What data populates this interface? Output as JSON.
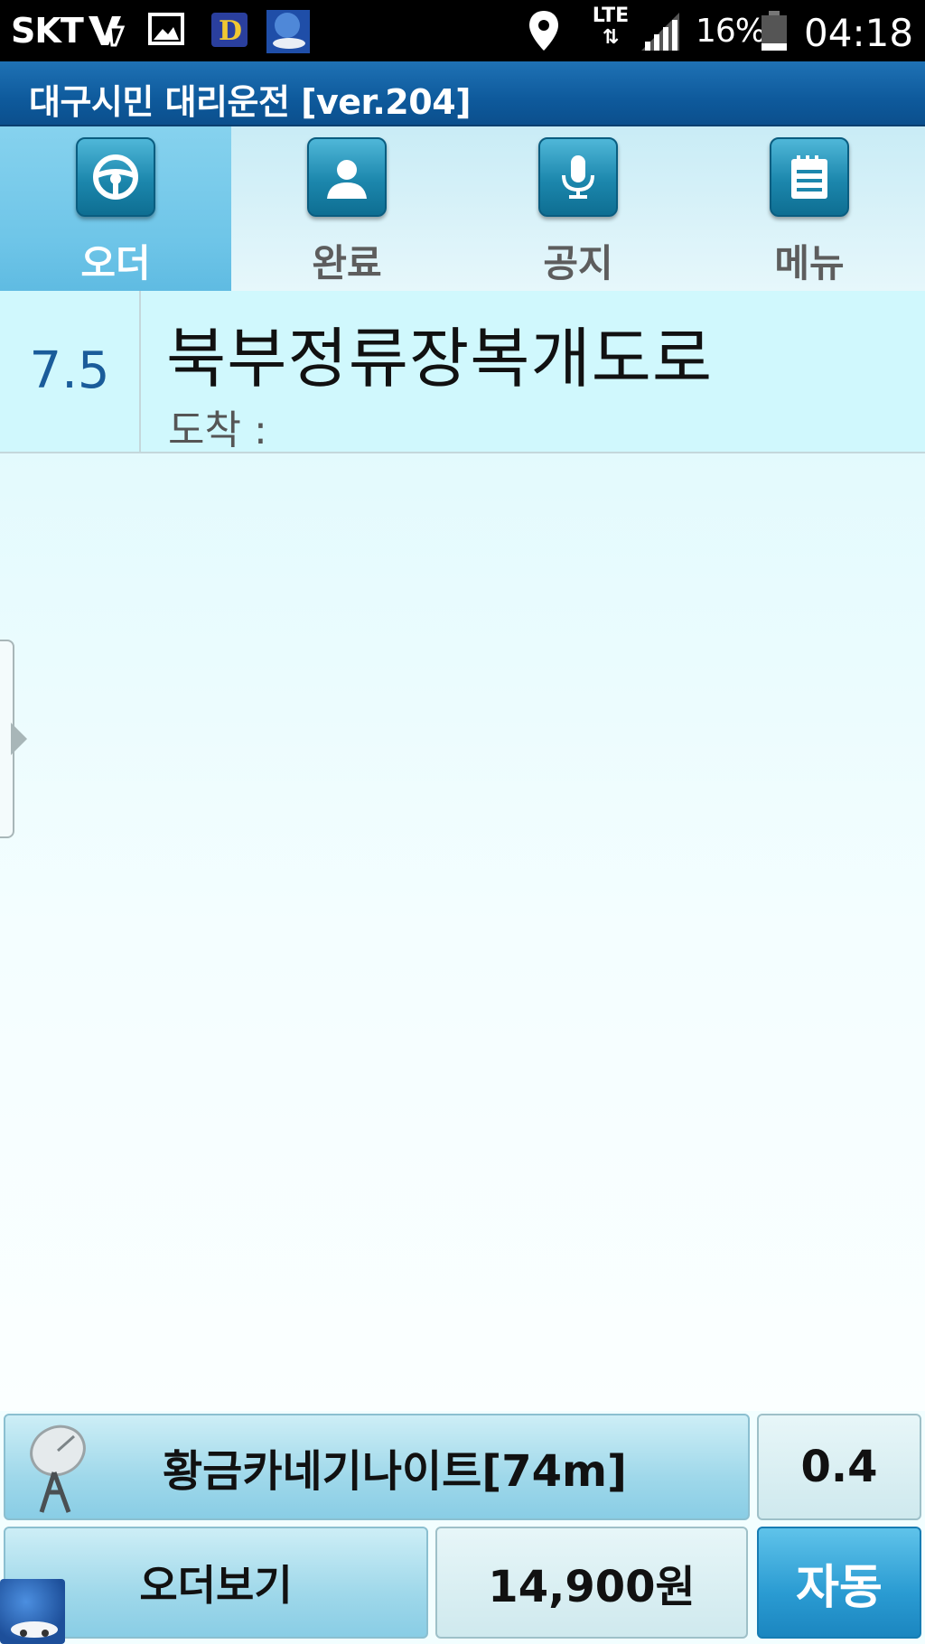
{
  "status_bar": {
    "carrier": "SKT",
    "network": "LTE",
    "battery": "16%",
    "time": "04:18",
    "icons": [
      "vpn-icon",
      "gallery-icon",
      "dict-app-icon",
      "driver-app-icon",
      "location-icon",
      "lte-icon",
      "signal-icon",
      "battery-icon"
    ]
  },
  "app": {
    "title": "대구시민 대리운전 [ver.204]"
  },
  "tabs": [
    {
      "label": "오더",
      "icon": "steering-wheel-icon",
      "active": true
    },
    {
      "label": "완료",
      "icon": "person-icon",
      "active": false
    },
    {
      "label": "공지",
      "icon": "microphone-icon",
      "active": false
    },
    {
      "label": "메뉴",
      "icon": "notepad-icon",
      "active": false
    }
  ],
  "order": {
    "distance": "7.5",
    "place": "북부정류장복개도로",
    "arrival_label": "도착 :"
  },
  "bottom": {
    "station_label": "황금카네기나이트[74m]",
    "station_value": "0.4",
    "view_orders": "오더보기",
    "fare": "14,900원",
    "auto": "자동"
  },
  "colors": {
    "title_bar": "#0e5a9c",
    "active_tab": "#6ec5e8",
    "order_row": "#d0f8fd",
    "distance_text": "#1a5c9a",
    "auto_button": "#2a9bd2"
  }
}
